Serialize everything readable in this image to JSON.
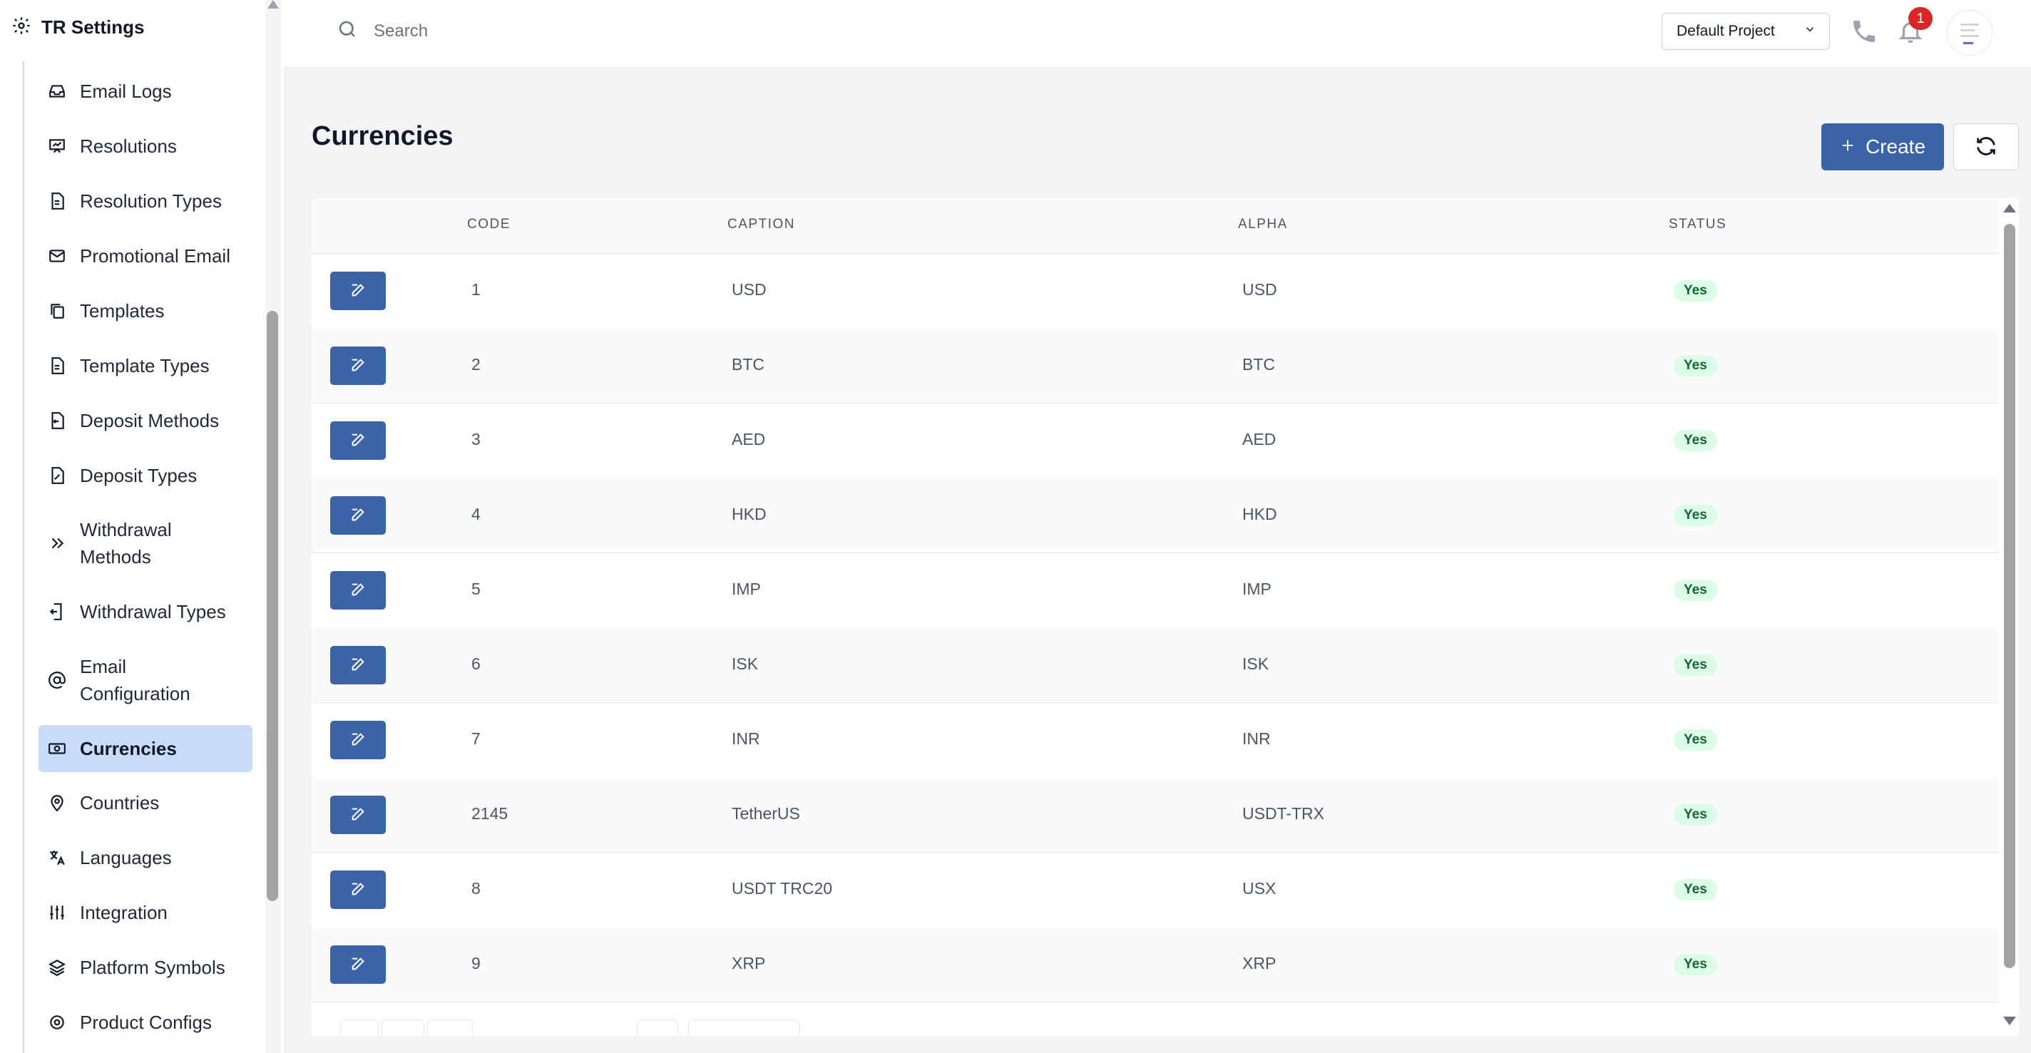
{
  "sidebar": {
    "title": "TR Settings",
    "items": [
      {
        "label": "Email Logs",
        "icon": "inbox-icon"
      },
      {
        "label": "Resolutions",
        "icon": "presentation-icon"
      },
      {
        "label": "Resolution Types",
        "icon": "document-icon"
      },
      {
        "label": "Promotional Email",
        "icon": "mail-icon"
      },
      {
        "label": "Templates",
        "icon": "copy-icon"
      },
      {
        "label": "Template Types",
        "icon": "document-icon"
      },
      {
        "label": "Deposit Methods",
        "icon": "file-deposit-icon"
      },
      {
        "label": "Deposit Types",
        "icon": "file-percent-icon"
      },
      {
        "label": "Withdrawal Methods",
        "icon": "double-chevron-right-icon"
      },
      {
        "label": "Withdrawal Types",
        "icon": "file-export-icon"
      },
      {
        "label": "Email Configuration",
        "icon": "at-sign-icon"
      },
      {
        "label": "Currencies",
        "icon": "banknote-icon",
        "active": true
      },
      {
        "label": "Countries",
        "icon": "map-pin-icon"
      },
      {
        "label": "Languages",
        "icon": "translate-icon"
      },
      {
        "label": "Integration",
        "icon": "sliders-icon"
      },
      {
        "label": "Platform Symbols",
        "icon": "layers-icon"
      },
      {
        "label": "Product Configs",
        "icon": "gear-icon"
      }
    ]
  },
  "topbar": {
    "search_placeholder": "Search",
    "project": "Default Project",
    "notification_count": "1"
  },
  "page": {
    "title": "Currencies",
    "create_label": "Create"
  },
  "table": {
    "columns": [
      "CODE",
      "CAPTION",
      "ALPHA",
      "STATUS"
    ],
    "rows": [
      {
        "code": "1",
        "caption": "USD",
        "alpha": "USD",
        "status": "Yes"
      },
      {
        "code": "2",
        "caption": "BTC",
        "alpha": "BTC",
        "status": "Yes"
      },
      {
        "code": "3",
        "caption": "AED",
        "alpha": "AED",
        "status": "Yes"
      },
      {
        "code": "4",
        "caption": "HKD",
        "alpha": "HKD",
        "status": "Yes"
      },
      {
        "code": "5",
        "caption": "IMP",
        "alpha": "IMP",
        "status": "Yes"
      },
      {
        "code": "6",
        "caption": "ISK",
        "alpha": "ISK",
        "status": "Yes"
      },
      {
        "code": "7",
        "caption": "INR",
        "alpha": "INR",
        "status": "Yes"
      },
      {
        "code": "2145",
        "caption": "TetherUS",
        "alpha": "USDT-TRX",
        "status": "Yes"
      },
      {
        "code": "8",
        "caption": "USDT TRC20",
        "alpha": "USX",
        "status": "Yes"
      },
      {
        "code": "9",
        "caption": "XRP",
        "alpha": "XRP",
        "status": "Yes"
      }
    ]
  },
  "colors": {
    "primary": "#3b64a8",
    "active_nav": "#c9dcf7",
    "status_bg": "#dcfce7",
    "status_text": "#166534",
    "badge": "#dc2626"
  }
}
